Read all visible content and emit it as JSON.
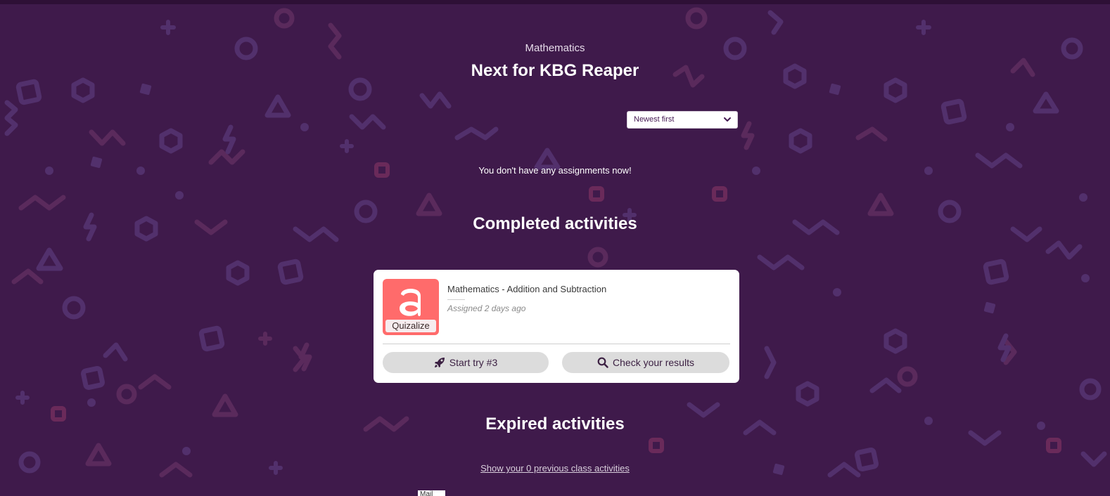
{
  "header": {
    "subject": "Mathematics",
    "title": "Next for KBG Reaper"
  },
  "sort": {
    "selected": "Newest first"
  },
  "assignments": {
    "empty_message": "You don't have any assignments now!"
  },
  "completed": {
    "heading": "Completed activities",
    "card": {
      "provider_label": "Quizalize",
      "title": "Mathematics - Addition and Subtraction",
      "assigned": "Assigned 2 days ago",
      "start_button": "Start try #3",
      "results_button": "Check your results",
      "start_icon": "rocket-icon",
      "results_icon": "search-icon"
    }
  },
  "expired": {
    "heading": "Expired activities",
    "link": "Show your 0 previous class activities"
  },
  "footer": {
    "mail_tab": "Mail"
  },
  "colors": {
    "background": "#3f1a4b",
    "card": "#ffffff",
    "quizalize": "#ff6b6b",
    "button": "#dcdcdc",
    "button_text": "#3c2143"
  }
}
